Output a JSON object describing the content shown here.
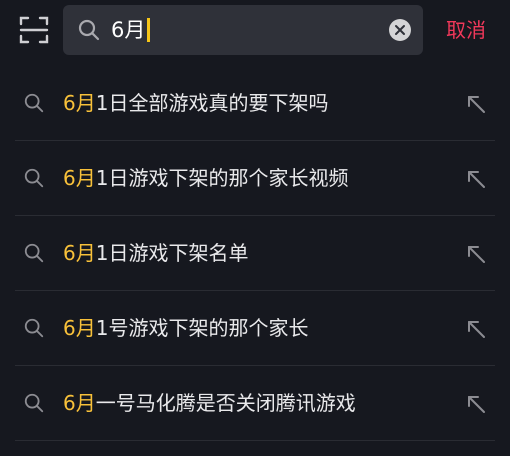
{
  "search": {
    "query": "6月",
    "cancel_label": "取消"
  },
  "suggestions": [
    {
      "highlight": "6月",
      "rest": "1日全部游戏真的要下架吗"
    },
    {
      "highlight": "6月",
      "rest": "1日游戏下架的那个家长视频"
    },
    {
      "highlight": "6月",
      "rest": "1日游戏下架名单"
    },
    {
      "highlight": "6月",
      "rest": "1号游戏下架的那个家长"
    },
    {
      "highlight": "6月",
      "rest": "一号马化腾是否关闭腾讯游戏"
    }
  ],
  "colors": {
    "background": "#16181f",
    "search_box": "#2f3139",
    "highlight": "#f8c13a",
    "cancel": "#f0385a",
    "caret": "#f5c518"
  },
  "icons": {
    "scan": "scan-icon",
    "search": "search-icon",
    "clear": "clear-icon",
    "fill": "arrow-up-left-icon"
  }
}
